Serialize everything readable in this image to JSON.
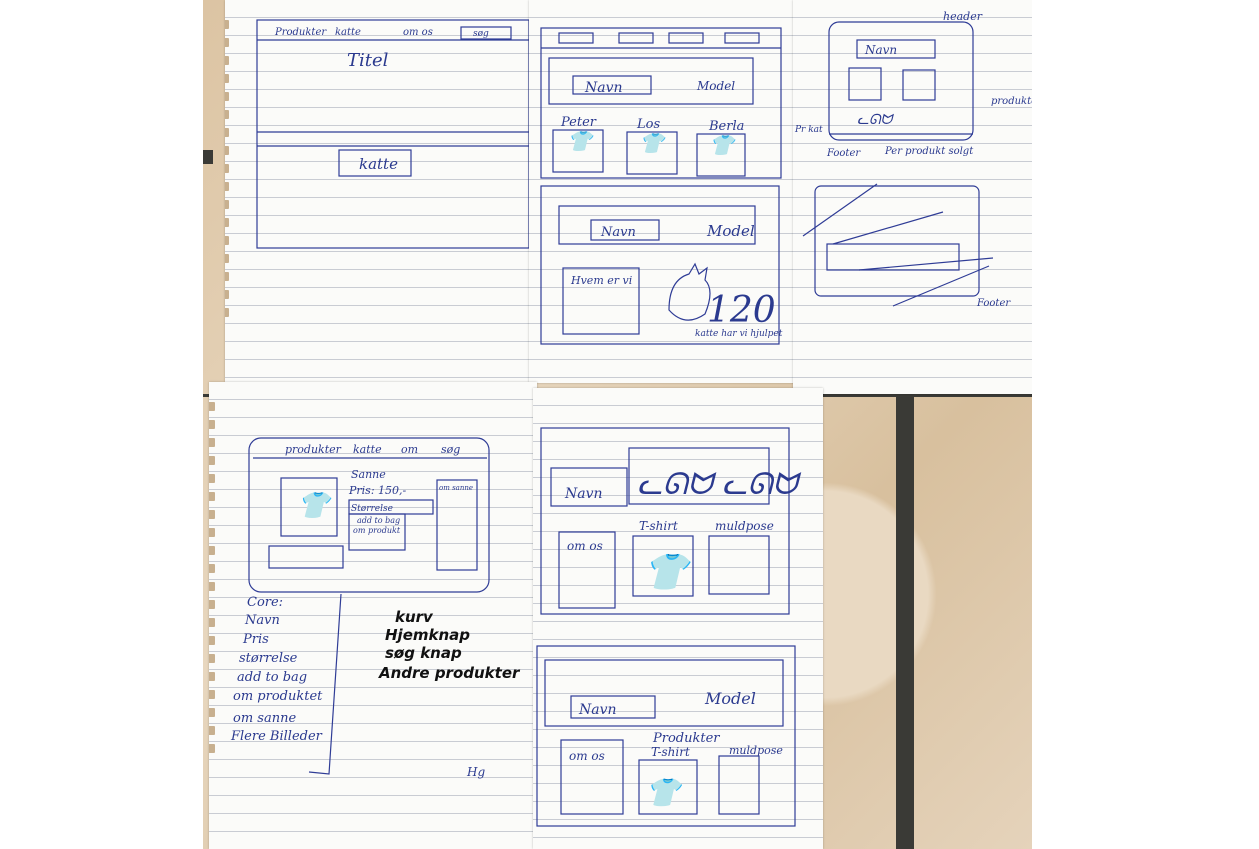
{
  "sheet1": {
    "nav": [
      "Produkter",
      "katte",
      "om os",
      "søg"
    ],
    "title": "Titel",
    "button": "katte"
  },
  "sheet2": {
    "name_box": "Navn",
    "model": "Model",
    "people": [
      "Peter",
      "Los",
      "Berla"
    ],
    "name_box2": "Navn",
    "model2": "Model",
    "who_we_are": "Hvem er vi",
    "count": "120",
    "caption": "katte har vi hjulpet"
  },
  "sheet3": {
    "header_label": "header",
    "name_box": "Navn",
    "products_label": "produkter",
    "cat_label": "Pr kat",
    "footer_label": "Footer",
    "sold_label": "Per produkt solgt",
    "footer_label2": "Footer"
  },
  "sheet4": {
    "nav": [
      "produkter",
      "katte",
      "om",
      "søg"
    ],
    "product_name": "Sanne",
    "price": "Pris: 150,-",
    "size": "Størrelse",
    "add_to_bag": "add to bag",
    "about_product": "om produkt",
    "side": "om sanne",
    "list_title": "Core:",
    "list": [
      "Navn",
      "Pris",
      "størrelse",
      "add to bag",
      "om produktet",
      "om sanne",
      "Flere Billeder"
    ],
    "bold_list": [
      "kurv",
      "Hjemknap",
      "søg knap",
      "Andre produkter"
    ],
    "signature": "Hg"
  },
  "sheet5": {
    "name_box": "Navn",
    "about": "om os",
    "tshirt": "T-shirt",
    "bag": "muldpose",
    "name_box2": "Navn",
    "model": "Model",
    "products": "Produkter",
    "about2": "om os",
    "tshirt2": "T-shirt",
    "bag2": "muldpose"
  }
}
